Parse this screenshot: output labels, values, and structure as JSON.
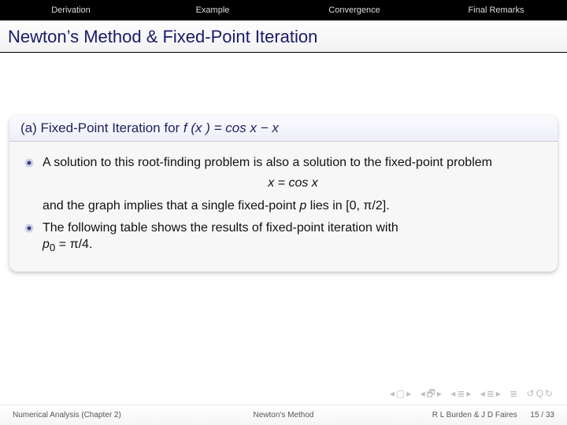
{
  "nav": {
    "items": [
      "Derivation",
      "Example",
      "Convergence",
      "Final Remarks"
    ]
  },
  "title": "Newton’s Method & Fixed-Point Iteration",
  "block": {
    "header_prefix": "(a) Fixed-Point Iteration for ",
    "header_math": "f (x ) = cos x − x",
    "b1a": "A solution to this root-finding problem is also a solution to the fixed-point problem",
    "eq": "x = cos x",
    "b1b_pre": "and the graph implies that a single fixed-point ",
    "b1b_p": "p",
    "b1b_post": " lies in [0, π/2].",
    "b2a": "The following table shows the results of fixed-point iteration with ",
    "b2b_p0": "p",
    "b2b_sub": "0",
    "b2b_post": " = π/4."
  },
  "footer": {
    "left": "Numerical Analysis (Chapter 2)",
    "center": "Newton's Method",
    "right": "R L Burden & J D Faires",
    "page": "15 / 33"
  }
}
